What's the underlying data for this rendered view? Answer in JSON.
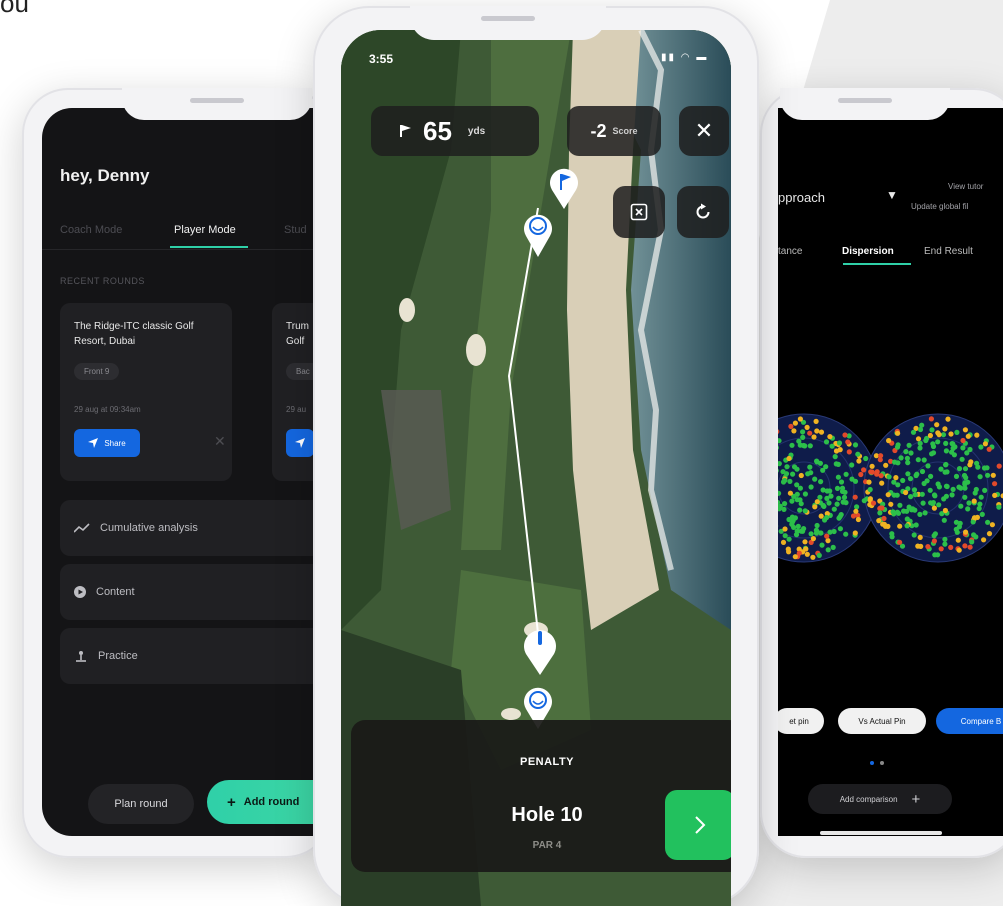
{
  "corner_text": "ou",
  "left_phone": {
    "greeting": "hey, Denny",
    "modes": [
      "Coach Mode",
      "Player Mode",
      "Stud"
    ],
    "section_label": "RECENT ROUNDS",
    "cards": [
      {
        "title": "The Ridge-ITC classic Golf Resort, Dubai",
        "chip": "Front 9",
        "date": "29 aug at 09:34am",
        "share_label": "Share"
      },
      {
        "title": "Trum Golf",
        "chip": "Bac",
        "date": "29 au",
        "share_label": ""
      }
    ],
    "menu": [
      "Cumulative analysis",
      "Content",
      "Practice"
    ],
    "plan_round": "Plan round",
    "add_round": "Add round"
  },
  "center_phone": {
    "time": "3:55",
    "yards": "65",
    "yards_unit": "yds",
    "score": "-2",
    "score_label": "Score",
    "penalty": "PENALTY",
    "hole": "Hole 10",
    "par": "PAR 4"
  },
  "right_phone": {
    "dropdown": "pproach",
    "view_tutorial": "View tutor",
    "update_global": "Update global fil",
    "tabs": [
      "tance",
      "Dispersion",
      "End Result"
    ],
    "pills": [
      "et pin",
      "Vs Actual Pin",
      "Compare B"
    ],
    "add_comparison": "Add comparison"
  },
  "colors": {
    "accent": "#2fd0a8",
    "blue": "#1467e0",
    "green_button": "#22c15e",
    "dark_bg": "#141416"
  }
}
